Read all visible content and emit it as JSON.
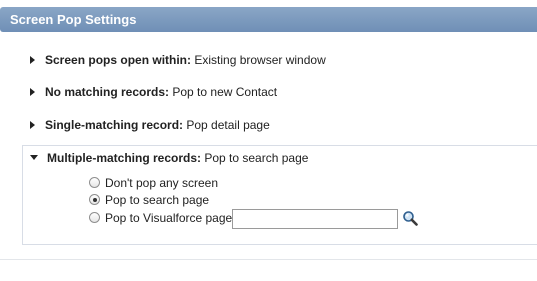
{
  "header": {
    "title": "Screen Pop Settings"
  },
  "settings": [
    {
      "label": "Screen pops open within:",
      "value": "Existing browser window"
    },
    {
      "label": "No matching records:",
      "value": "Pop to new Contact"
    },
    {
      "label": "Single-matching record:",
      "value": "Pop detail page"
    },
    {
      "label": "Multiple-matching records:",
      "value": "Pop to search page"
    }
  ],
  "multiple": {
    "options": [
      {
        "label": "Don't pop any screen",
        "selected": false
      },
      {
        "label": "Pop to search page",
        "selected": true
      },
      {
        "label": "Pop to Visualforce page",
        "selected": false
      }
    ],
    "visualforce_value": "",
    "visualforce_placeholder": ""
  },
  "icons": {
    "collapsed": "caret-right-icon",
    "expanded": "caret-down-icon",
    "lookup": "lookup-magnifier-icon"
  },
  "colors": {
    "header_bg": "#7a98bd",
    "header_text": "#ffffff",
    "box_border": "#d8dde6"
  }
}
